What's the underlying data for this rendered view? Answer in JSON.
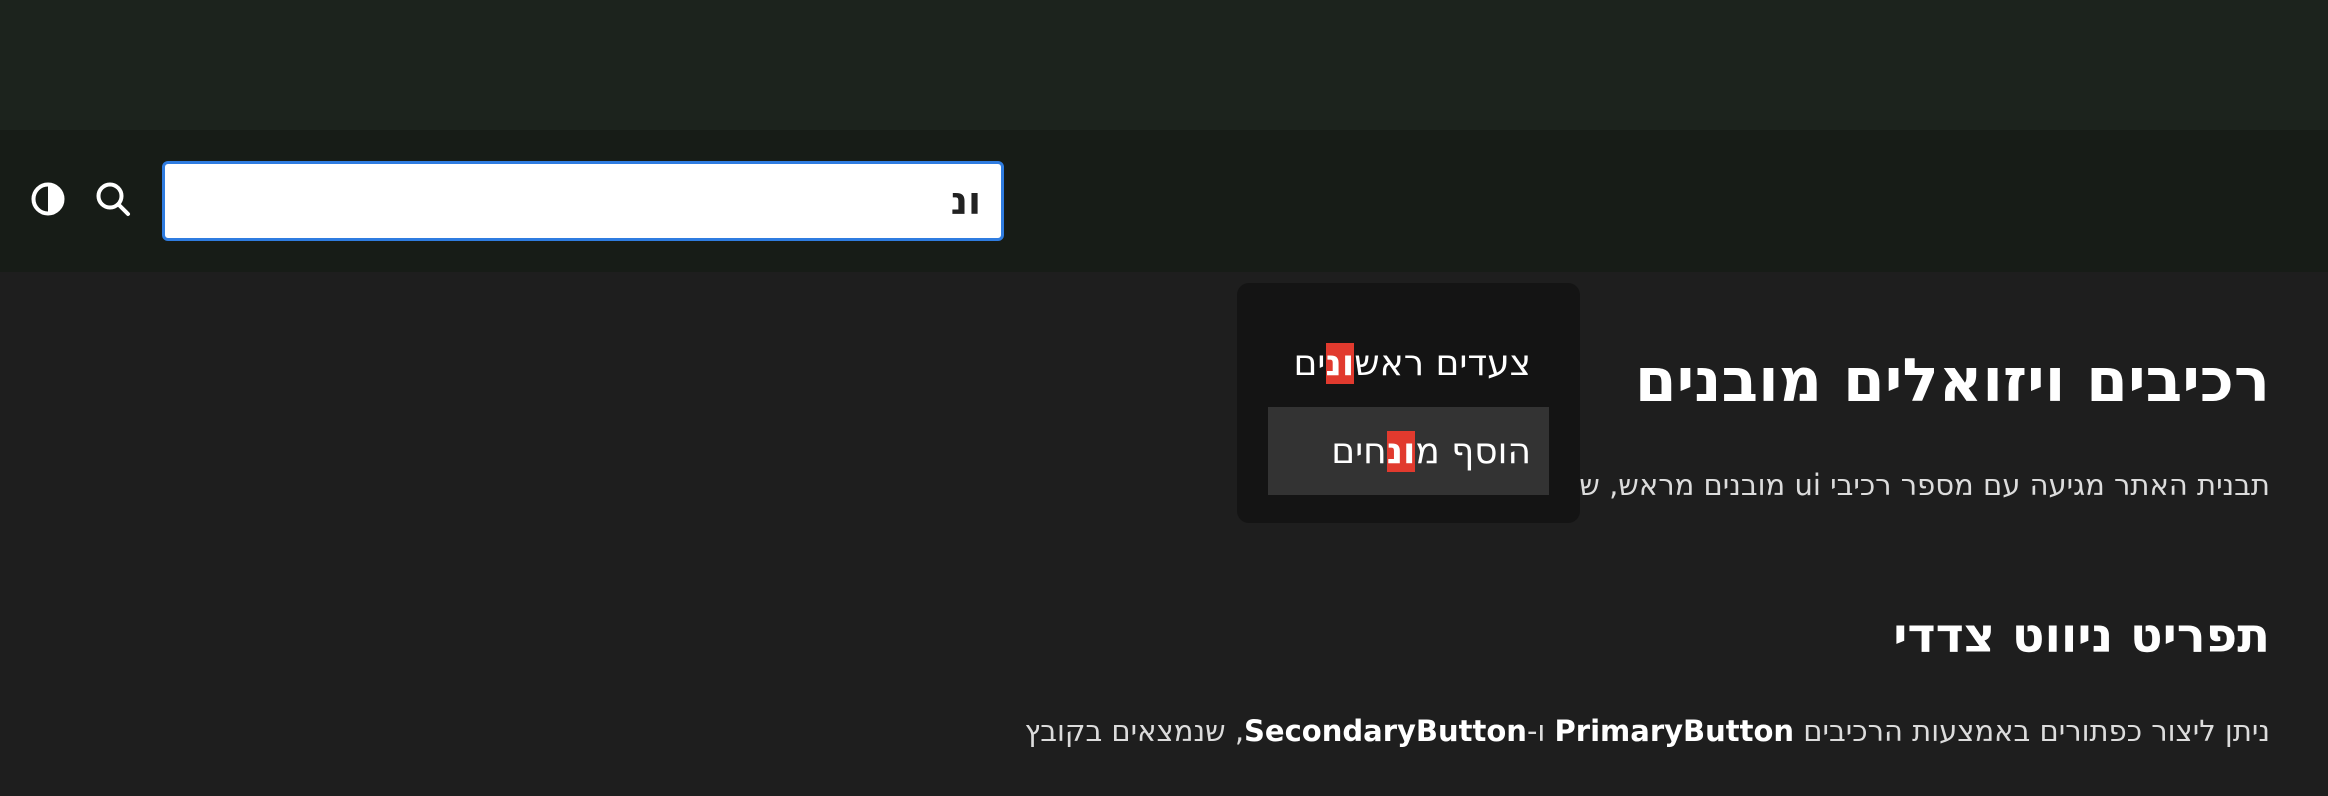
{
  "colors": {
    "accent_focus": "#2f7ce0",
    "highlight": "#e13a2e",
    "header_bg": "#171c17",
    "page_bg": "#1e1e1e"
  },
  "header": {
    "icons": [
      "contrast-icon",
      "search-icon"
    ],
    "search": {
      "value": "ונ",
      "placeholder": ""
    }
  },
  "search_results": [
    {
      "before": "צעדים ראש",
      "match": "ונ",
      "after": "ים",
      "active": false
    },
    {
      "before": "הוסף מ",
      "match": "ונ",
      "after": "חים",
      "active": true
    }
  ],
  "main": {
    "title": "רכיבים ויזואלים מובנים",
    "description": "תבנית האתר מגיעה עם מספר רכיבי ui מובנים מראש, שישית לצרכים שלכם.",
    "section_title": "תפריט ניווט צדדי",
    "section_desc_start": "ניתן ליצור כפתורים באמצעות הרכיבים ",
    "section_desc_code1": "PrimaryButton",
    "section_desc_mid": " ו-",
    "section_desc_code2": "SecondaryButton",
    "section_desc_end": ", שנמצאים בקובץ"
  }
}
